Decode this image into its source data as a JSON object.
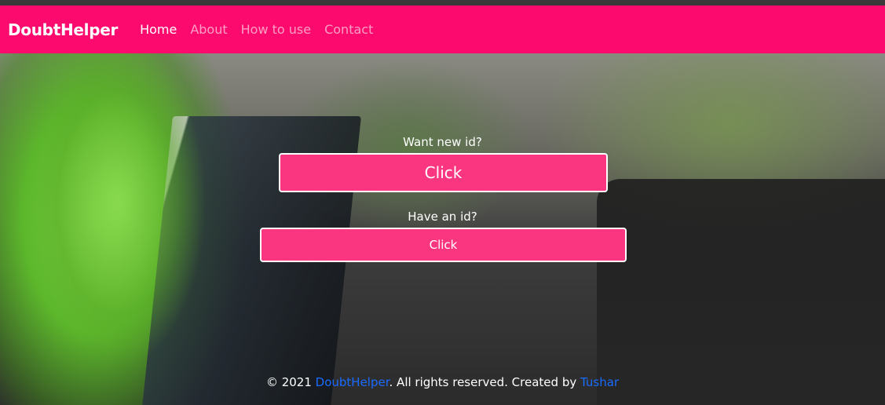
{
  "navbar": {
    "brand": "DoubtHelper",
    "links": [
      {
        "label": "Home",
        "active": true
      },
      {
        "label": "About",
        "active": false
      },
      {
        "label": "How to use",
        "active": false
      },
      {
        "label": "Contact",
        "active": false
      }
    ],
    "background_color": "#fc0a6d"
  },
  "main": {
    "new_id_label": "Want new id?",
    "new_id_button": "Click",
    "have_id_label": "Have an id?",
    "have_id_button": "Click",
    "button_color": "#fb3680"
  },
  "footer": {
    "prefix": "© 2021 ",
    "brand_link": "DoubtHelper",
    "middle": ". All rights reserved. Created by ",
    "author_link": "Tushar",
    "link_color": "#1a6bff"
  }
}
